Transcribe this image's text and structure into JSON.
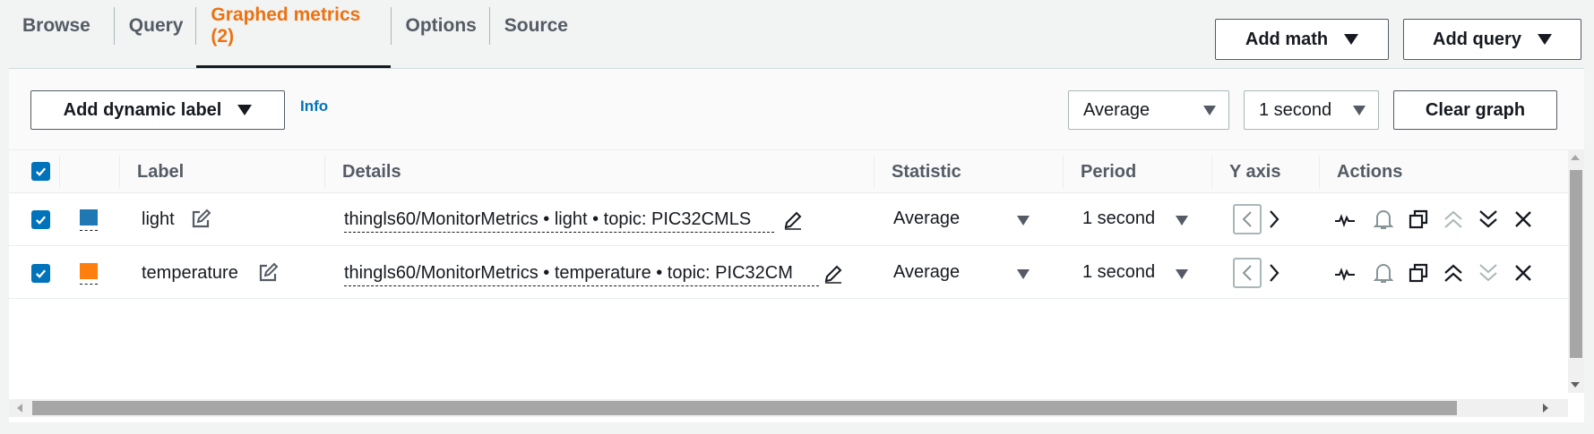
{
  "tabs": [
    {
      "label": "Browse",
      "active": false
    },
    {
      "label": "Query",
      "active": false
    },
    {
      "label": "Graphed metrics (2)",
      "active": true
    },
    {
      "label": "Options",
      "active": false
    },
    {
      "label": "Source",
      "active": false
    }
  ],
  "top_actions": {
    "add_math": "Add math",
    "add_query": "Add query"
  },
  "toolbar": {
    "add_dynamic_label": "Add dynamic label",
    "info": "Info",
    "statistic_select": "Average",
    "period_select": "1 second",
    "clear_graph": "Clear graph"
  },
  "table": {
    "headers": {
      "label": "Label",
      "details": "Details",
      "statistic": "Statistic",
      "period": "Period",
      "yaxis": "Y axis",
      "actions": "Actions"
    },
    "rows": [
      {
        "checked": true,
        "color": "#1f77b4",
        "label": "light",
        "details": "thingls60/MonitorMetrics • light • topic: PIC32CMLS",
        "statistic": "Average",
        "period": "1 second"
      },
      {
        "checked": true,
        "color": "#ff7f0e",
        "label": "temperature",
        "details": "thingls60/MonitorMetrics • temperature • topic: PIC32CM",
        "statistic": "Average",
        "period": "1 second"
      }
    ]
  },
  "colors": {
    "accent": "#ec7211",
    "link": "#0073bb",
    "checkbox": "#0073bb"
  },
  "icons": [
    "edit-icon",
    "pencil-icon",
    "chevron-left-icon",
    "chevron-right-icon",
    "anomaly-icon",
    "bell-icon",
    "duplicate-icon",
    "move-up-icon",
    "move-down-icon",
    "close-icon"
  ]
}
